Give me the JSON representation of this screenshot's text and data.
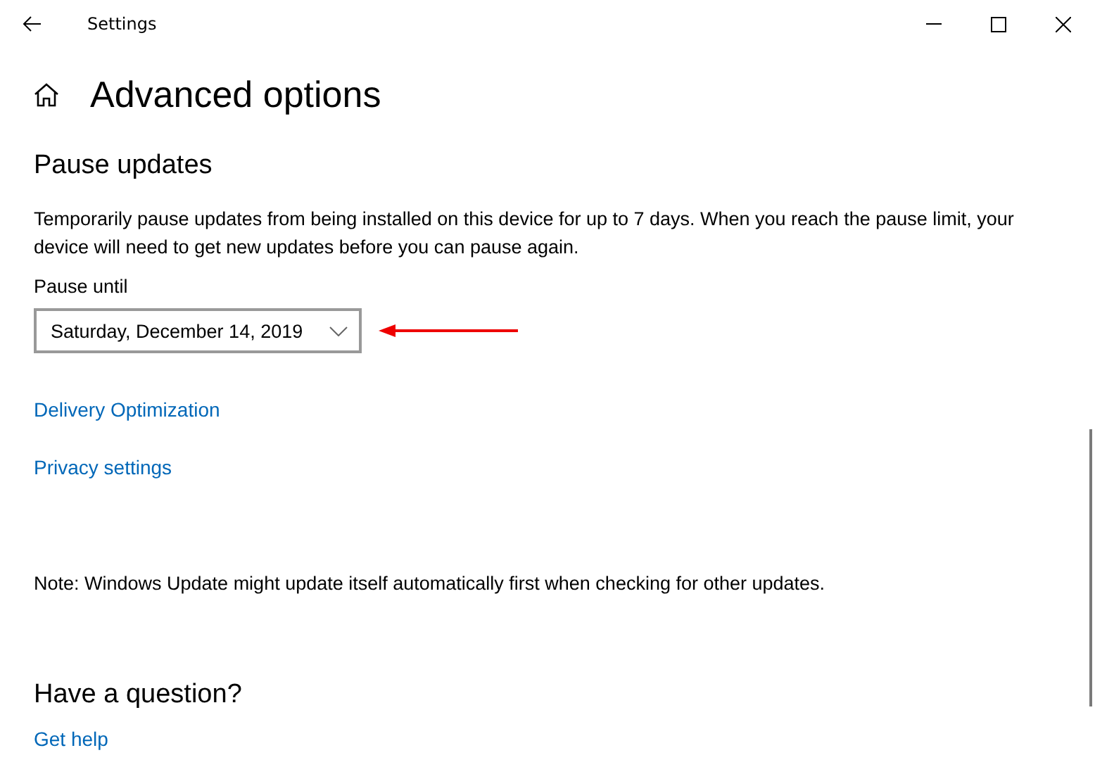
{
  "window": {
    "title": "Settings"
  },
  "page_title": "Advanced options",
  "section": {
    "heading": "Pause updates",
    "description": "Temporarily pause updates from being installed on this device for up to 7 days. When you reach the pause limit, your device will need to get new updates before you can pause again.",
    "field_label": "Pause until",
    "dropdown_value": "Saturday, December 14, 2019"
  },
  "links": [
    "Delivery Optimization",
    "Privacy settings"
  ],
  "note": "Note: Windows Update might update itself automatically first when checking for other updates.",
  "help": {
    "heading": "Have a question?",
    "link": "Get help"
  }
}
